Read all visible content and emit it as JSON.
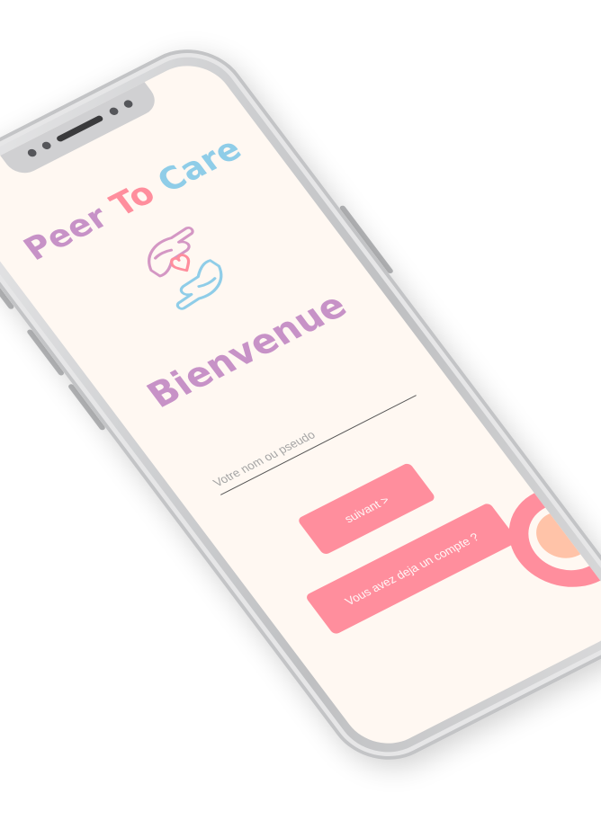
{
  "app": {
    "title_word1": "Peer",
    "title_word2": "To",
    "title_word3": "Care",
    "welcome": "Bienvenue"
  },
  "form": {
    "name_placeholder": "Votre nom ou pseudo",
    "name_value": "",
    "next_label": "suivant >",
    "login_label": "Vous avez deja un compte ?"
  },
  "colors": {
    "background": "#fff8f2",
    "accent_pink": "#ff8e9d",
    "accent_purple": "#c792c7",
    "accent_blue": "#8fcde8",
    "accent_peach": "#ffc3a8"
  },
  "icons": {
    "logo": "hands-heart-icon"
  }
}
